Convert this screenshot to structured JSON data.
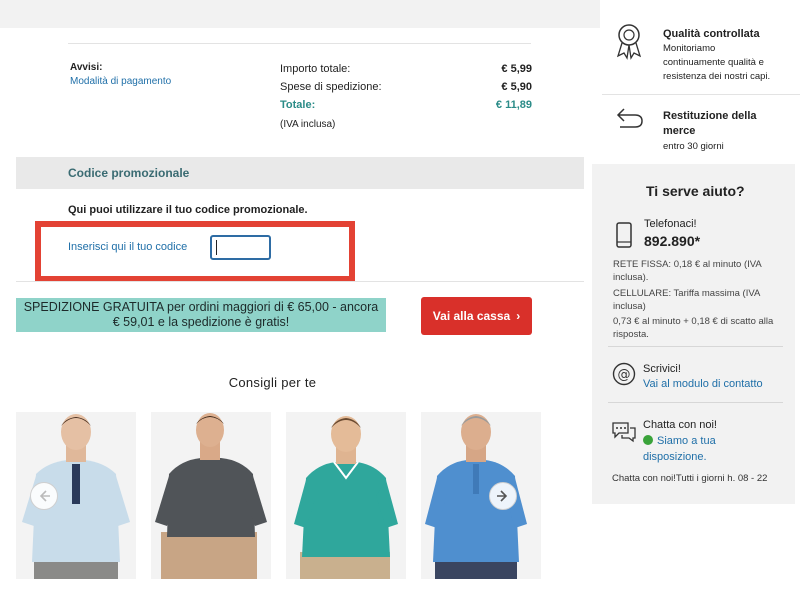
{
  "summary": {
    "notices_label": "Avvisi:",
    "payment_link": "Modalità di pagamento",
    "total_amount_label": "Importo totale:",
    "total_amount_value": "€ 5,99",
    "shipping_label": "Spese di spedizione:",
    "shipping_value": "€ 5,90",
    "total_label": "Totale:",
    "total_value": "€ 11,89",
    "vat_note": "(IVA inclusa)"
  },
  "promo": {
    "section_title": "Codice promozionale",
    "intro": "Qui puoi utilizzare il tuo codice promozionale.",
    "input_label": "Inserisci qui il tuo codice",
    "input_value": ""
  },
  "shipping_banner": {
    "line1": "SPEDIZIONE GRATUITA per ordini maggiori di € 65,00 - ancora",
    "line2": "€ 59,01 e la spedizione è gratis!"
  },
  "checkout": {
    "label": "Vai alla cassa",
    "arrow": "›"
  },
  "recommendations": {
    "title": "Consigli per te",
    "products": [
      {
        "icon": "light-blue-henley-tshirt",
        "color": "#c8dcea"
      },
      {
        "icon": "dark-grey-henley-tshirt",
        "color": "#505458"
      },
      {
        "icon": "teal-polo-shirt",
        "color": "#2fa79c"
      },
      {
        "icon": "blue-henley-shirt",
        "color": "#4f8fcf"
      }
    ],
    "prev_icon": "arrow-left-icon",
    "next_icon": "arrow-right-icon"
  },
  "benefits": {
    "quality_title": "Qualità controllata",
    "quality_text_1": "Monitoriamo",
    "quality_text_2": "continuamente qualità e",
    "quality_text_3": "resistenza dei nostri capi.",
    "return_title_1": "Restituzione della",
    "return_title_2": "merce",
    "return_text": "entro 30 giorni"
  },
  "help": {
    "title": "Ti serve aiuto?",
    "call_label": "Telefonaci!",
    "phone": "892.890*",
    "landline_1": "RETE FISSA: 0,18 € al minuto (IVA",
    "landline_2": "inclusa).",
    "mobile_1": "CELLULARE: Tariffa massima (IVA",
    "mobile_2": "inclusa)",
    "mobile_3": "0,73 € al minuto + 0,18 € di scatto alla",
    "mobile_4": "risposta.",
    "write_label": "Scrivici!",
    "contact_link": "Vai al modulo di contatto",
    "chat_label": "Chatta con noi!",
    "chat_status_1": "Siamo a tua",
    "chat_status_2": "disposizione.",
    "chat_hours": "Chatta con noi!Tutti i giorni h. 08 - 22"
  },
  "colors": {
    "accent_red": "#d9302a",
    "teal_text": "#2b8c88",
    "banner_teal": "#8fd3c9",
    "link_blue": "#1f6fa8"
  }
}
